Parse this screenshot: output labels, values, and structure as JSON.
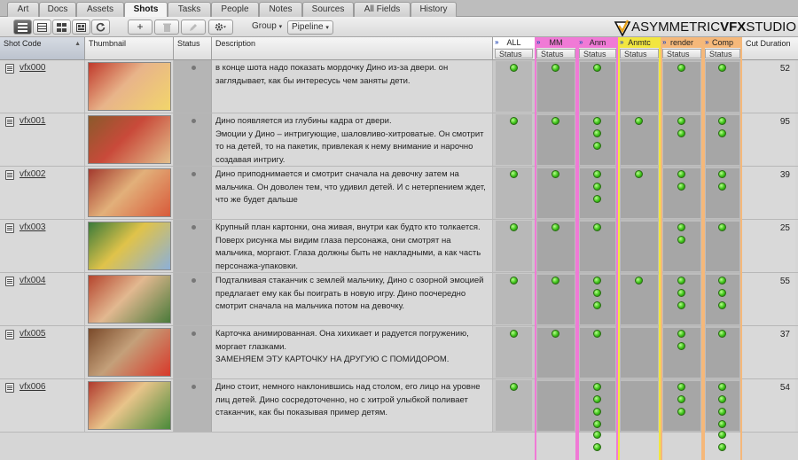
{
  "tabs": [
    {
      "label": "Art",
      "active": false
    },
    {
      "label": "Docs",
      "active": false
    },
    {
      "label": "Assets",
      "active": false
    },
    {
      "label": "Shots",
      "active": true
    },
    {
      "label": "Tasks",
      "active": false
    },
    {
      "label": "People",
      "active": false
    },
    {
      "label": "Notes",
      "active": false
    },
    {
      "label": "Sources",
      "active": false
    },
    {
      "label": "All Fields",
      "active": false
    },
    {
      "label": "History",
      "active": false
    }
  ],
  "toolbar": {
    "view_icons": [
      "list-view-icon",
      "compact-list-icon",
      "thumbnail-grid-icon",
      "filmstrip-icon",
      "refresh-icon"
    ],
    "add_label": "+",
    "delete_icon": "trash-icon",
    "edit_icon": "pencil-icon",
    "settings_icon": "gear-icon",
    "group_label": "Group",
    "pipeline_label": "Pipeline"
  },
  "logo": {
    "part1": "ASYMMETRIC",
    "part2": "VFX",
    "part3": "STUDIO"
  },
  "columns": {
    "shot_code": "Shot Code",
    "thumbnail": "Thumbnail",
    "status": "Status",
    "description": "Description",
    "cut_duration": "Cut Duration"
  },
  "pipeline_groups": [
    {
      "name": "ALL",
      "sub": "Status",
      "color": "#ffffff"
    },
    {
      "name": "MM",
      "sub": "Status",
      "color": "#f07ad6"
    },
    {
      "name": "Anm",
      "sub": "Status",
      "color": "#f07ad6"
    },
    {
      "name": "Anmtc",
      "sub": "Status",
      "color": "#f2e640"
    },
    {
      "name": "render",
      "sub": "Status",
      "color": "#f5b87a"
    },
    {
      "name": "Comp",
      "sub": "Status",
      "color": "#f5b87a"
    }
  ],
  "rows": [
    {
      "code": "vfx000",
      "desc": "в конце шота надо показать мордочку Дино из-за двери. он заглядывает, как бы интересусь чем заняты дети.",
      "cut": "52",
      "tasks": [
        1,
        1,
        1,
        0,
        1,
        1
      ]
    },
    {
      "code": "vfx001",
      "desc": "Дино появляется  из глубины кадра от двери.\n Эмоции у Дино – интригующие, шаловливо-хитроватые. Он смотрит то на детей, то на пакетик, привлекая к нему внимание и нарочно создавая интригу.",
      "cut": "95",
      "tasks": [
        1,
        1,
        3,
        1,
        2,
        2
      ]
    },
    {
      "code": "vfx002",
      "desc": "Дино приподнимается  и смотрит сначала на девочку затем на мальчика. Он доволен тем, что удивил детей. И с нетерпением ждет, что же будет дальше",
      "cut": "39",
      "tasks": [
        1,
        1,
        3,
        1,
        2,
        2
      ]
    },
    {
      "code": "vfx003",
      "desc": "Крупный план картонки, она живая, внутри как будто кто толкается. Поверх рисунка мы видим глаза персонажа, они смотрят на мальчика, моргают. Глаза должны быть не накладными, а как часть персонажа-упаковки.",
      "cut": "25",
      "tasks": [
        1,
        1,
        1,
        0,
        2,
        1
      ]
    },
    {
      "code": "vfx004",
      "desc": "Подталкивая стаканчик с землей мальчику, Дино с озорной эмоцией предлагает ему как бы поиграть в новую игру. Дино поочередно смотрит сначала на мальчика потом на девочку.",
      "cut": "55",
      "tasks": [
        1,
        1,
        3,
        1,
        3,
        3
      ]
    },
    {
      "code": "vfx005",
      "desc": "Карточка анимированная. Она хихикает и радуется погружению, моргает глазками.\nЗАМЕНЯЕМ ЭТУ КАРТОЧКУ НА ДРУГУЮ С ПОМИДОРОМ.",
      "cut": "37",
      "tasks": [
        1,
        1,
        1,
        0,
        2,
        1
      ]
    },
    {
      "code": "vfx006",
      "desc": "Дино стоит, немного наклонившись над столом, его лицо на уровне лиц детей. Дино сосредоточенно, но с хитрой улыбкой поливает стаканчик, как бы показывая пример детям.",
      "cut": "54",
      "tasks": [
        1,
        0,
        6,
        0,
        3,
        6
      ]
    }
  ]
}
